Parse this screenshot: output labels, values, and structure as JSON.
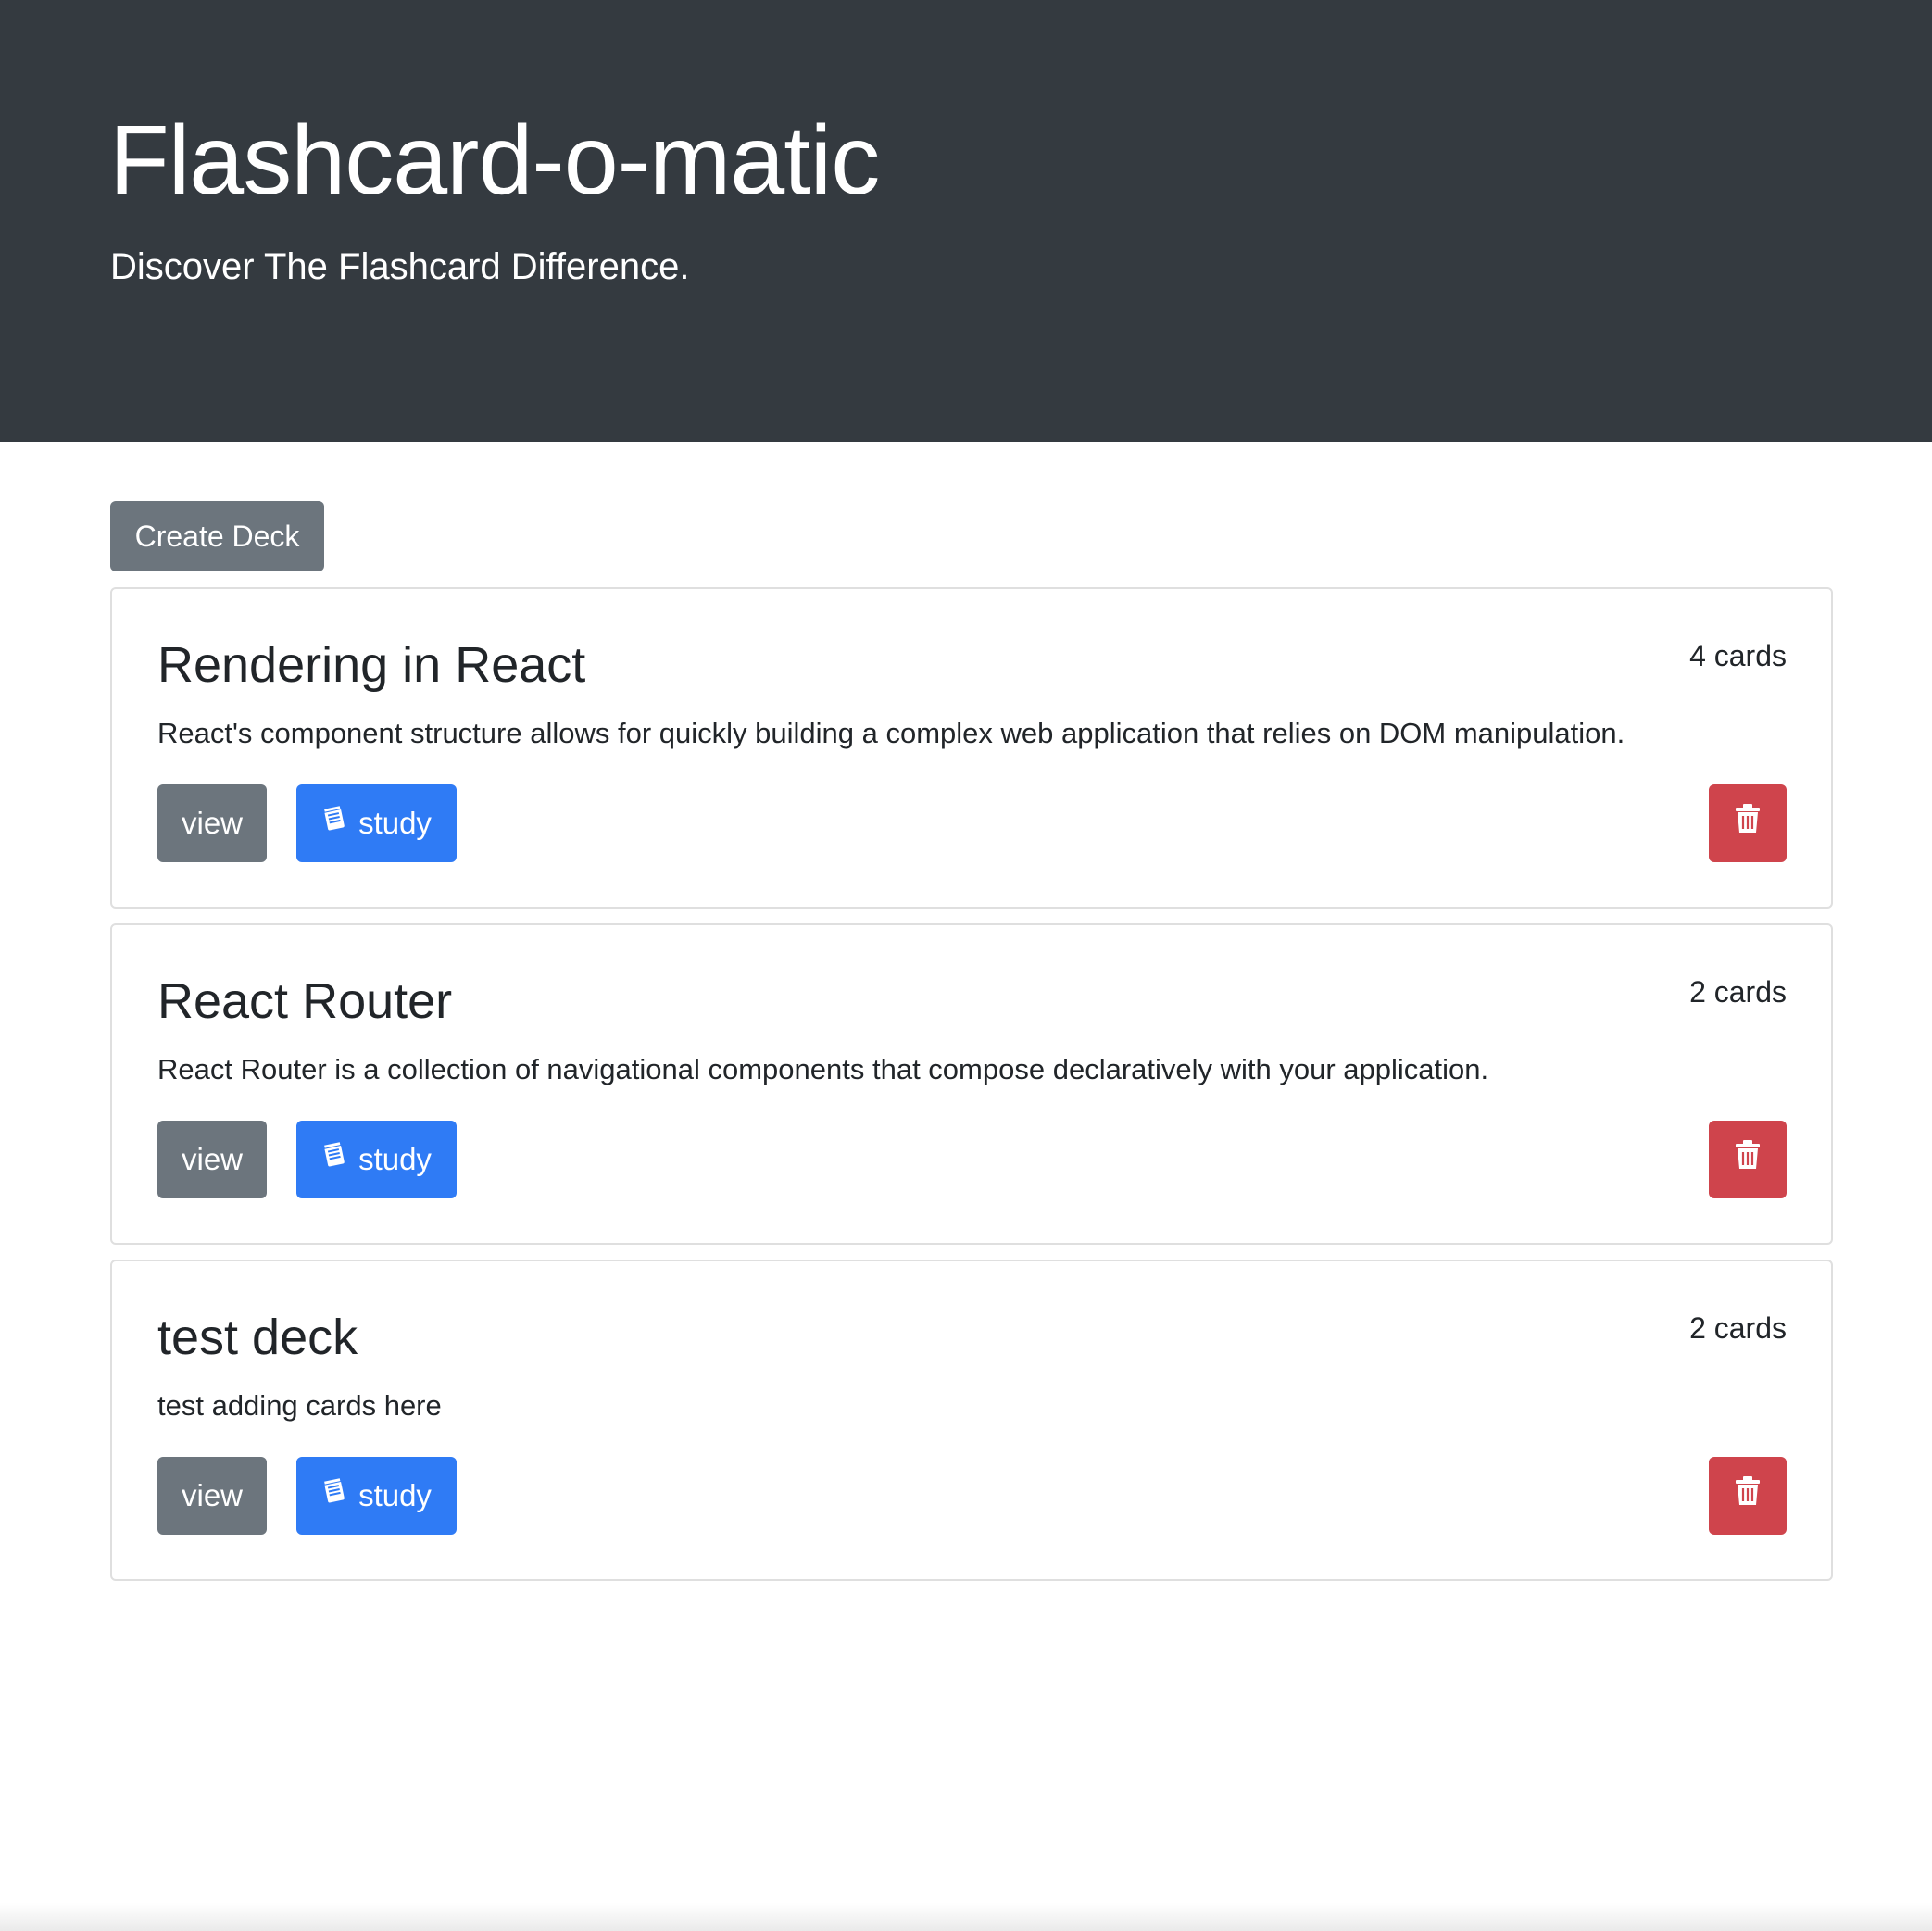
{
  "header": {
    "title": "Flashcard-o-matic",
    "tagline": "Discover The Flashcard Difference."
  },
  "toolbar": {
    "create_deck_label": "Create Deck"
  },
  "colors": {
    "header_bg": "#343a40",
    "secondary": "#6c757d",
    "primary": "#2f7bf5",
    "danger": "#cf444c"
  },
  "decks": [
    {
      "name": "Rendering in React",
      "count": "4 cards",
      "description": "React's component structure allows for quickly building a complex web application that relies on DOM manipulation.",
      "view_label": "view",
      "study_label": "study",
      "study_icon": "study-notepad-icon",
      "delete_icon": "trash-icon"
    },
    {
      "name": "React Router",
      "count": "2 cards",
      "description": "React Router is a collection of navigational components that compose declaratively with your application.",
      "view_label": "view",
      "study_label": "study",
      "study_icon": "study-notepad-icon",
      "delete_icon": "trash-icon"
    },
    {
      "name": "test deck",
      "count": "2 cards",
      "description": "test adding cards here",
      "view_label": "view",
      "study_label": "study",
      "study_icon": "study-notepad-icon",
      "delete_icon": "trash-icon"
    }
  ]
}
